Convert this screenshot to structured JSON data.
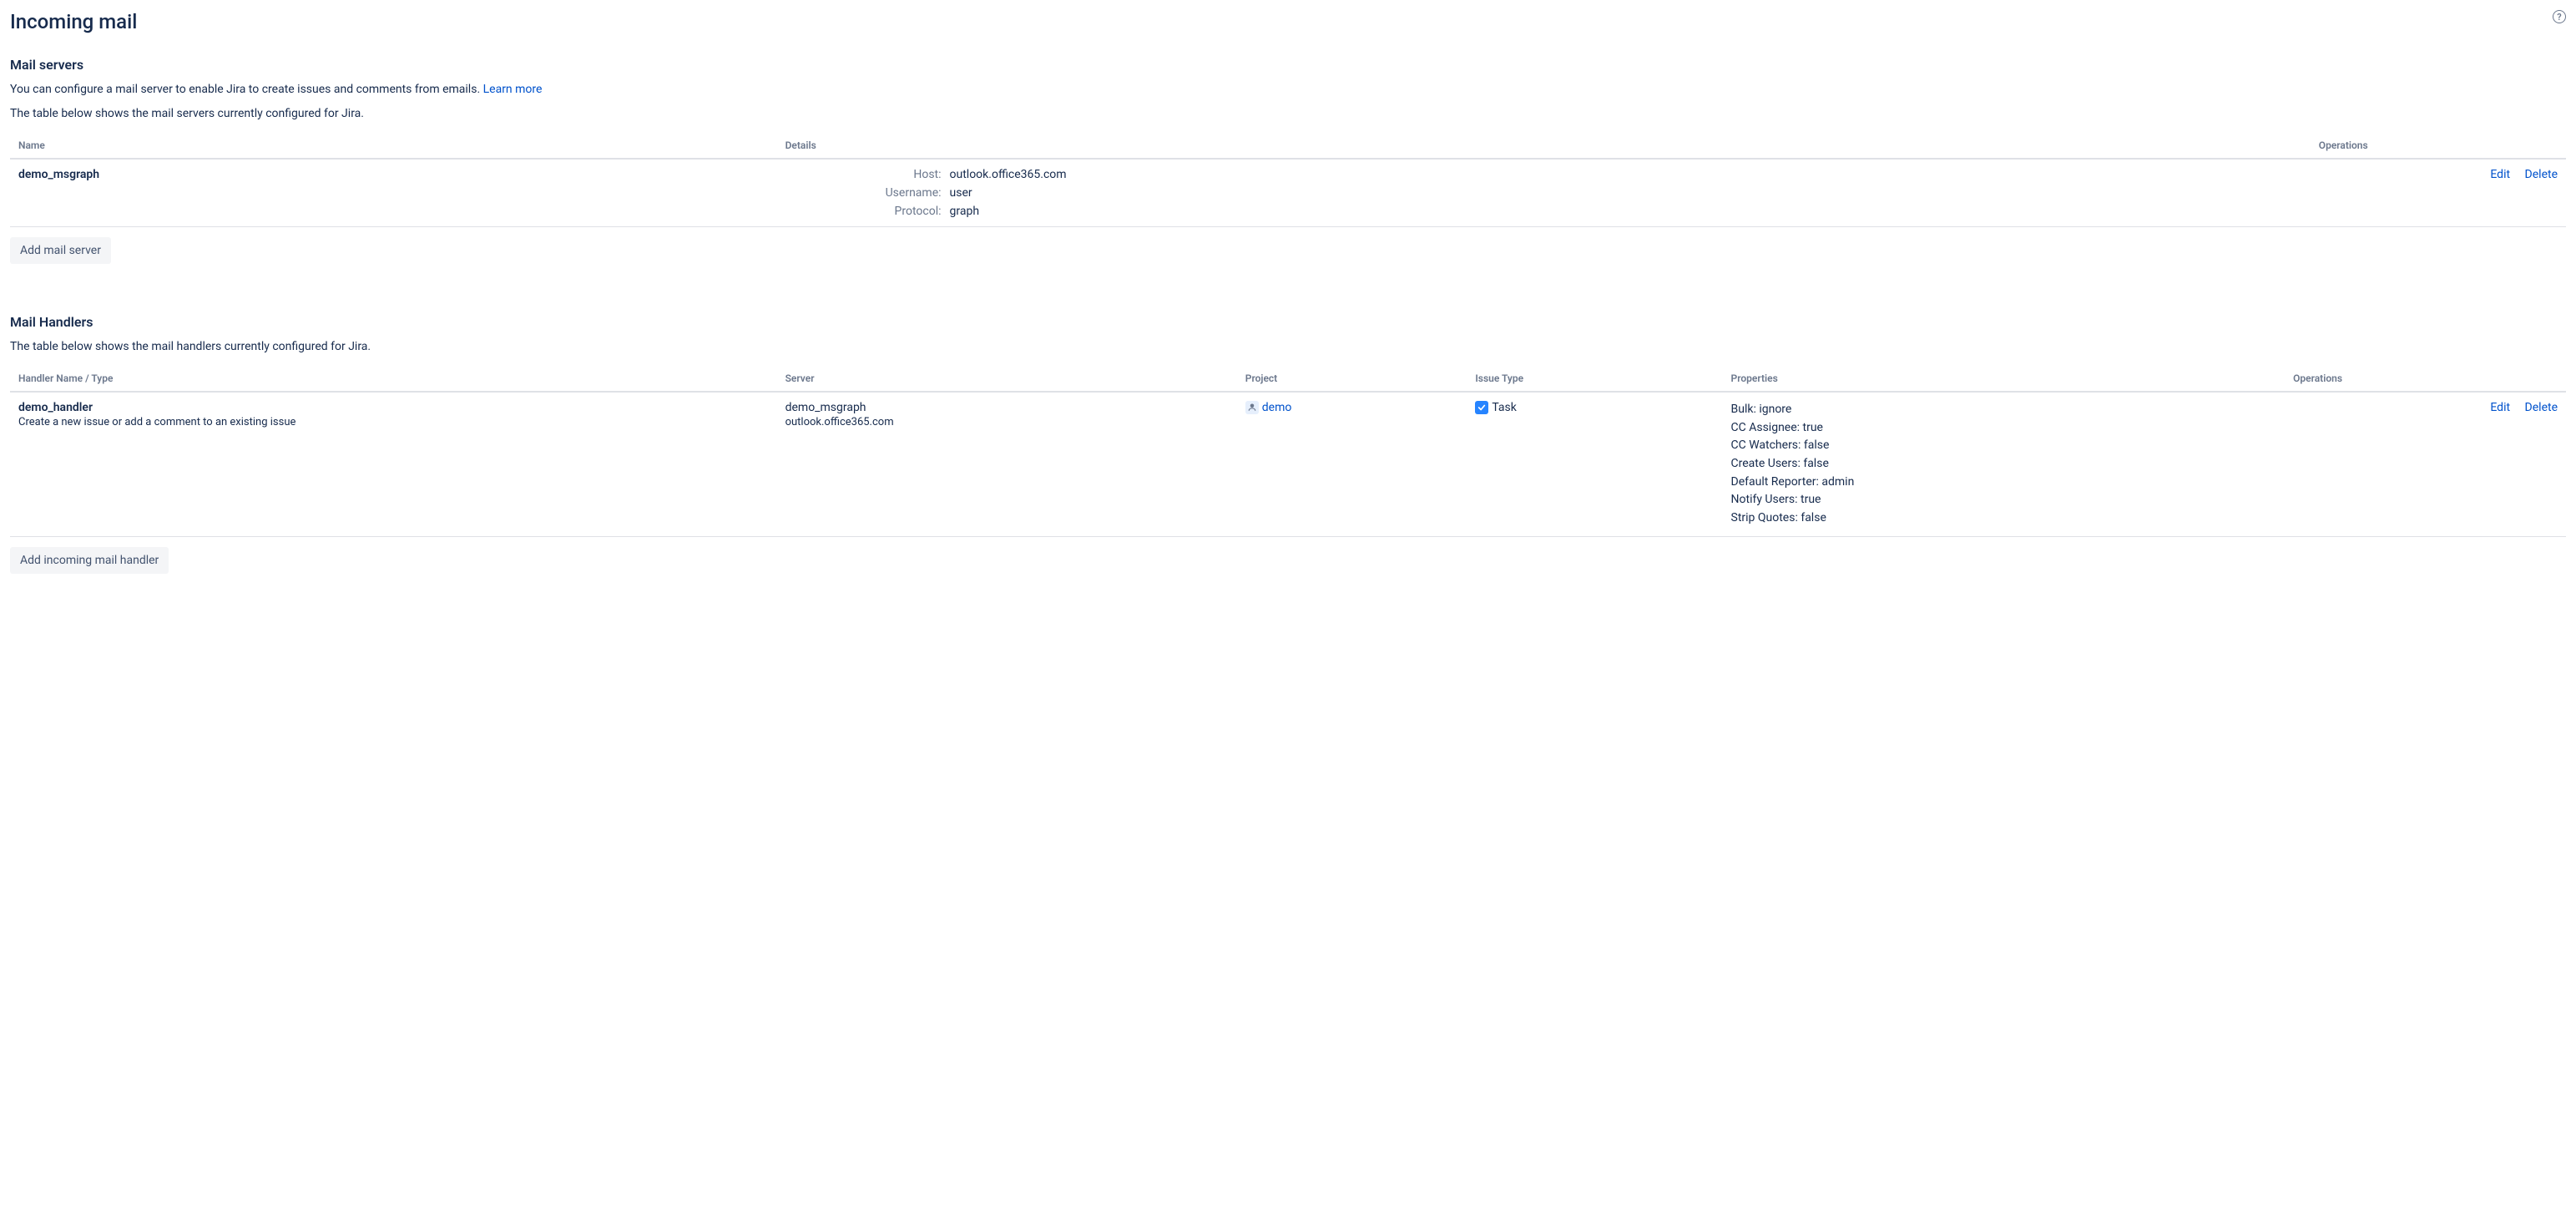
{
  "page": {
    "title": "Incoming mail"
  },
  "mail_servers": {
    "heading": "Mail servers",
    "description_prefix": "You can configure a mail server to enable Jira to create issues and comments from emails. ",
    "learn_more": "Learn more",
    "description_2": "The table below shows the mail servers currently configured for Jira.",
    "columns": {
      "name": "Name",
      "details": "Details",
      "operations": "Operations"
    },
    "rows": [
      {
        "name": "demo_msgraph",
        "host_label": "Host:",
        "host_value": "outlook.office365.com",
        "username_label": "Username:",
        "username_value": "user",
        "protocol_label": "Protocol:",
        "protocol_value": "graph",
        "edit": "Edit",
        "delete": "Delete"
      }
    ],
    "add_button": "Add mail server"
  },
  "mail_handlers": {
    "heading": "Mail Handlers",
    "description": "The table below shows the mail handlers currently configured for Jira.",
    "columns": {
      "handler": "Handler Name / Type",
      "server": "Server",
      "project": "Project",
      "issue_type": "Issue Type",
      "properties": "Properties",
      "operations": "Operations"
    },
    "rows": [
      {
        "name": "demo_handler",
        "type_desc": "Create a new issue or add a comment to an existing issue",
        "server_name": "demo_msgraph",
        "server_host": "outlook.office365.com",
        "project": "demo",
        "issue_type": "Task",
        "properties": [
          {
            "key": "Bulk:",
            "value": "ignore"
          },
          {
            "key": "CC Assignee:",
            "value": "true"
          },
          {
            "key": "CC Watchers:",
            "value": "false"
          },
          {
            "key": "Create Users:",
            "value": "false"
          },
          {
            "key": "Default Reporter:",
            "value": "admin"
          },
          {
            "key": "Notify Users:",
            "value": "true"
          },
          {
            "key": "Strip Quotes:",
            "value": "false"
          }
        ],
        "edit": "Edit",
        "delete": "Delete"
      }
    ],
    "add_button": "Add incoming mail handler"
  }
}
